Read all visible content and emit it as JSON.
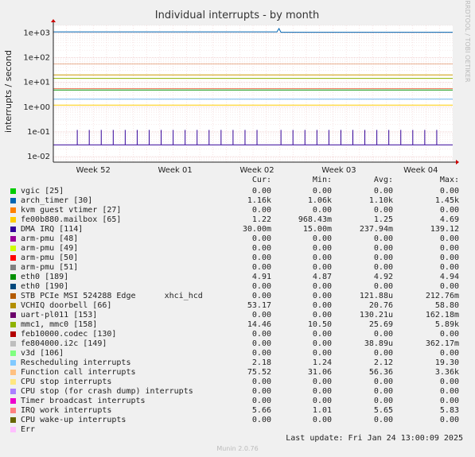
{
  "chart_data": {
    "type": "line",
    "title": "Individual interrupts - by month",
    "ylabel": "interrupts / second",
    "xlabel": "",
    "y_scale": "log",
    "ylim": [
      0.006,
      2000
    ],
    "y_ticks": [
      "1e-02",
      "1e-01",
      "1e+00",
      "1e+01",
      "1e+02",
      "1e+03"
    ],
    "x_ticks": [
      "Week 52",
      "Week 01",
      "Week 02",
      "Week 03",
      "Week 04"
    ],
    "grid": true,
    "side_label": "RRDTOOL / TOBI OETIKER",
    "series": [
      {
        "name": "arch_timer [30]",
        "color": "#0066b3",
        "level": 1100,
        "segments": [
          [
            0.0,
            1100
          ],
          [
            0.56,
            1100
          ],
          [
            0.565,
            1500
          ],
          [
            0.57,
            1060
          ],
          [
            1.0,
            1060
          ]
        ]
      },
      {
        "name": "DMA IRQ [114]",
        "color": "#330099",
        "level": 0.03,
        "segments": [
          [
            0.0,
            0.03
          ],
          [
            1.0,
            0.03
          ]
        ],
        "spikes": [
          0.06,
          0.09,
          0.12,
          0.15,
          0.18,
          0.21,
          0.24,
          0.27,
          0.3,
          0.33,
          0.36,
          0.39,
          0.42,
          0.45,
          0.48,
          0.51,
          0.57,
          0.6,
          0.63,
          0.66,
          0.69,
          0.72,
          0.75,
          0.78,
          0.81,
          0.84,
          0.87,
          0.9,
          0.93,
          0.96
        ],
        "spike_level": 0.12
      },
      {
        "name": "eth0 [189]",
        "color": "#008f00",
        "level": 4.9,
        "segments": [
          [
            0.0,
            4.9
          ],
          [
            1.0,
            4.9
          ]
        ]
      },
      {
        "name": "VCHIQ doorbell [66]",
        "color": "#cc9900",
        "level": 20,
        "segments": [
          [
            0.0,
            20
          ],
          [
            1.0,
            20
          ]
        ]
      },
      {
        "name": "mmc1, mmc0 [158]",
        "color": "#8fb300",
        "level": 14.5,
        "segments": [
          [
            0.0,
            14.5
          ],
          [
            1.0,
            14.5
          ]
        ]
      },
      {
        "name": "Rescheduling interrupts",
        "color": "#6fb7f0",
        "level": 2.1,
        "segments": [
          [
            0.0,
            2.1
          ],
          [
            1.0,
            2.1
          ]
        ]
      },
      {
        "name": "Function call interrupts",
        "color": "#e8b090",
        "level": 56,
        "segments": [
          [
            0.0,
            56
          ],
          [
            1.0,
            56
          ]
        ]
      },
      {
        "name": "IRQ work interrupts",
        "color": "#f08060",
        "level": 5.6,
        "segments": [
          [
            0.0,
            5.6
          ],
          [
            1.0,
            5.6
          ]
        ]
      },
      {
        "name": "fe00b880.mailbox [65]",
        "color": "#ffcc00",
        "level": 1.2,
        "segments": [
          [
            0.0,
            1.2
          ],
          [
            1.0,
            1.2
          ]
        ]
      }
    ]
  },
  "legend": {
    "headers": {
      "cur": "Cur:",
      "min": "Min:",
      "avg": "Avg:",
      "max": "Max:"
    },
    "rows": [
      {
        "name": "vgic [25]",
        "color": "#00cc00",
        "cur": "0.00",
        "min": "0.00",
        "avg": "0.00",
        "max": "0.00"
      },
      {
        "name": "arch_timer [30]",
        "color": "#0066b3",
        "cur": "1.16k",
        "min": "1.06k",
        "avg": "1.10k",
        "max": "1.45k"
      },
      {
        "name": "kvm guest vtimer [27]",
        "color": "#ff8000",
        "cur": "0.00",
        "min": "0.00",
        "avg": "0.00",
        "max": "0.00"
      },
      {
        "name": "fe00b880.mailbox [65]",
        "color": "#ffcc00",
        "cur": "1.22",
        "min": "968.43m",
        "avg": "1.25",
        "max": "4.69"
      },
      {
        "name": "DMA IRQ [114]",
        "color": "#330099",
        "cur": "30.00m",
        "min": "15.00m",
        "avg": "237.94m",
        "max": "139.12"
      },
      {
        "name": "arm-pmu [48]",
        "color": "#990099",
        "cur": "0.00",
        "min": "0.00",
        "avg": "0.00",
        "max": "0.00"
      },
      {
        "name": "arm-pmu [49]",
        "color": "#ccff00",
        "cur": "0.00",
        "min": "0.00",
        "avg": "0.00",
        "max": "0.00"
      },
      {
        "name": "arm-pmu [50]",
        "color": "#ff0000",
        "cur": "0.00",
        "min": "0.00",
        "avg": "0.00",
        "max": "0.00"
      },
      {
        "name": "arm-pmu [51]",
        "color": "#808080",
        "cur": "0.00",
        "min": "0.00",
        "avg": "0.00",
        "max": "0.00"
      },
      {
        "name": "eth0 [189]",
        "color": "#008f00",
        "cur": "4.91",
        "min": "4.87",
        "avg": "4.92",
        "max": "4.94"
      },
      {
        "name": "eth0 [190]",
        "color": "#00487d",
        "cur": "0.00",
        "min": "0.00",
        "avg": "0.00",
        "max": "0.00"
      },
      {
        "name": "STB PCIe MSI 524288 Edge      xhci_hcd",
        "color": "#b35a00",
        "cur": "0.00",
        "min": "0.00",
        "avg": "121.88u",
        "max": "212.76m"
      },
      {
        "name": "VCHIQ doorbell [66]",
        "color": "#b38f00",
        "cur": "53.17",
        "min": "0.00",
        "avg": "20.76",
        "max": "58.80"
      },
      {
        "name": "uart-pl011 [153]",
        "color": "#6b006b",
        "cur": "0.00",
        "min": "0.00",
        "avg": "130.21u",
        "max": "162.18m"
      },
      {
        "name": "mmc1, mmc0 [158]",
        "color": "#8fb300",
        "cur": "14.46",
        "min": "10.50",
        "avg": "25.69",
        "max": "5.89k"
      },
      {
        "name": "feb10000.codec [130]",
        "color": "#b30000",
        "cur": "0.00",
        "min": "0.00",
        "avg": "0.00",
        "max": "0.00"
      },
      {
        "name": "fe804000.i2c [149]",
        "color": "#bebebe",
        "cur": "0.00",
        "min": "0.00",
        "avg": "38.89u",
        "max": "362.17m"
      },
      {
        "name": "v3d [106]",
        "color": "#80ff80",
        "cur": "0.00",
        "min": "0.00",
        "avg": "0.00",
        "max": "0.00"
      },
      {
        "name": "Rescheduling interrupts",
        "color": "#80c9ff",
        "cur": "2.18",
        "min": "1.24",
        "avg": "2.12",
        "max": "19.30"
      },
      {
        "name": "Function call interrupts",
        "color": "#ffc080",
        "cur": "75.52",
        "min": "31.06",
        "avg": "56.36",
        "max": "3.36k"
      },
      {
        "name": "CPU stop interrupts",
        "color": "#ffe680",
        "cur": "0.00",
        "min": "0.00",
        "avg": "0.00",
        "max": "0.00"
      },
      {
        "name": "CPU stop (for crash dump) interrupts",
        "color": "#aa80ff",
        "cur": "0.00",
        "min": "0.00",
        "avg": "0.00",
        "max": "0.00"
      },
      {
        "name": "Timer broadcast interrupts",
        "color": "#ee00cc",
        "cur": "0.00",
        "min": "0.00",
        "avg": "0.00",
        "max": "0.00"
      },
      {
        "name": "IRQ work interrupts",
        "color": "#ff8080",
        "cur": "5.66",
        "min": "1.01",
        "avg": "5.65",
        "max": "5.83"
      },
      {
        "name": "CPU wake-up interrupts",
        "color": "#666600",
        "cur": "0.00",
        "min": "0.00",
        "avg": "0.00",
        "max": "0.00"
      },
      {
        "name": "Err",
        "color": "#ffbfff",
        "cur": "",
        "min": "",
        "avg": "",
        "max": ""
      }
    ]
  },
  "footer": {
    "last_update": "Last update: Fri Jan 24 13:00:09 2025",
    "generator": "Munin 2.0.76"
  }
}
